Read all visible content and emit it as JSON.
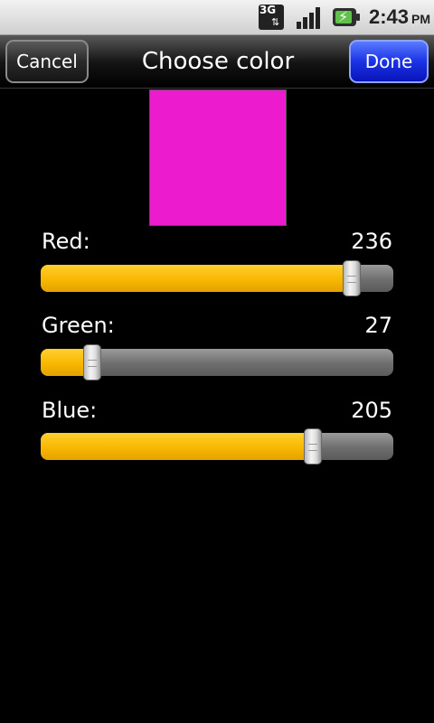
{
  "status_bar": {
    "network_icon": "3g-data-icon",
    "network_text": "3G",
    "signal_icon": "signal-strength-icon",
    "battery_icon": "battery-charging-icon",
    "time": "2:43",
    "ampm": "PM"
  },
  "titlebar": {
    "cancel_label": "Cancel",
    "title": "Choose color",
    "done_label": "Done"
  },
  "preview": {
    "color": "#EC1BCD"
  },
  "sliders": [
    {
      "label": "Red:",
      "value": "236",
      "max": 255
    },
    {
      "label": "Green:",
      "value": "27",
      "max": 255
    },
    {
      "label": "Blue:",
      "value": "205",
      "max": 255
    }
  ],
  "colors": {
    "accent_fill": "#F8B700",
    "done_button": "#1A33E6",
    "background": "#000000"
  }
}
